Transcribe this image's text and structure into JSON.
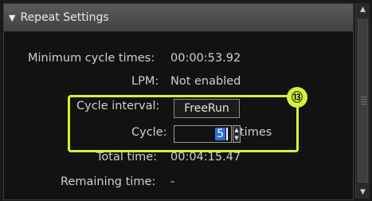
{
  "section": {
    "title": "Repeat Settings",
    "caret_icon": "triangle-down-icon"
  },
  "rows": {
    "min_cycle_label": "Minimum cycle times:",
    "min_cycle_value": "00:00:53.92",
    "lpm_label": "LPM:",
    "lpm_value": "Not enabled",
    "cycle_interval_label": "Cycle interval:",
    "cycle_interval_value": "FreeRun",
    "cycle_label": "Cycle:",
    "cycle_value": "5",
    "cycle_unit": "times",
    "total_label": "Total time:",
    "total_value": "00:04:15.47",
    "remaining_label": "Remaining time:",
    "remaining_value": "-"
  },
  "callout": {
    "number": "⑬",
    "color": "#d7f03a"
  }
}
